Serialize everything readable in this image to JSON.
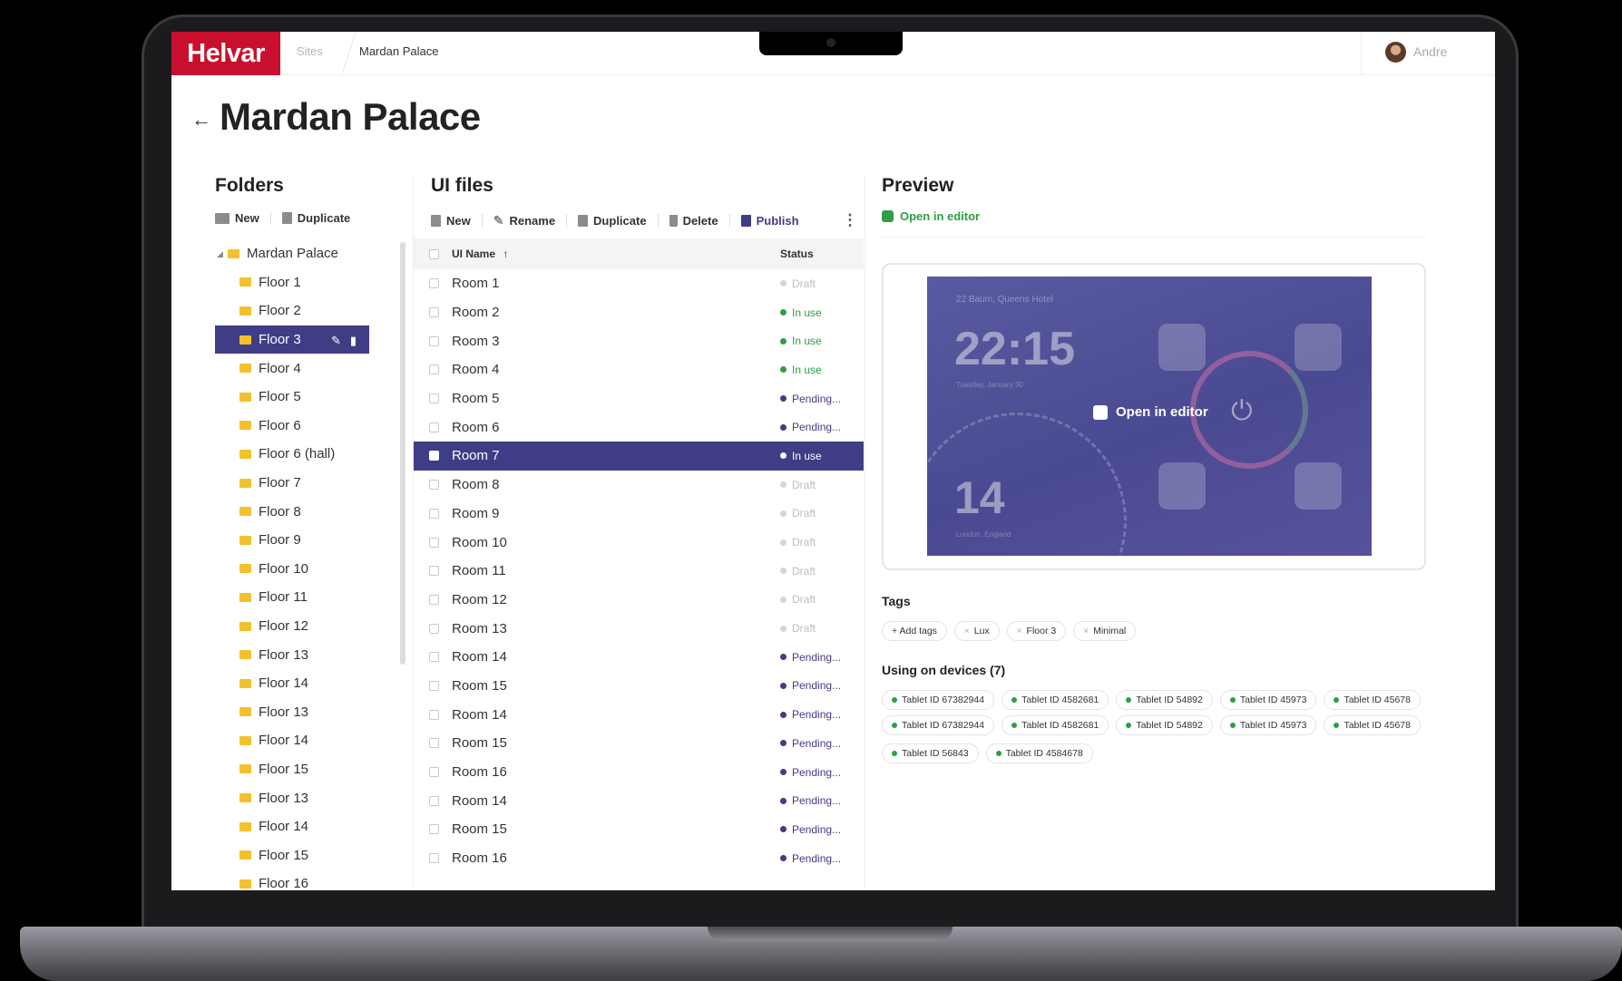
{
  "header": {
    "logo": "Helvar",
    "breadcrumb_sites": "Sites",
    "breadcrumb_current": "Mardan Palace",
    "user_name": "Andre"
  },
  "page": {
    "back_icon": "arrow-left-icon",
    "title": "Mardan Palace"
  },
  "folders": {
    "title": "Folders",
    "toolbar": {
      "new_label": "New",
      "duplicate_label": "Duplicate"
    },
    "root": "Mardan Palace",
    "items": [
      "Floor 1",
      "Floor 2",
      "Floor 3",
      "Floor 4",
      "Floor 5",
      "Floor 6",
      "Floor 6 (hall)",
      "Floor 7",
      "Floor 8",
      "Floor 9",
      "Floor 10",
      "Floor 11",
      "Floor 12",
      "Floor 13",
      "Floor 14",
      "Floor 13",
      "Floor 14",
      "Floor 15",
      "Floor 13",
      "Floor 14",
      "Floor 15",
      "Floor 16"
    ],
    "selected_index": 2
  },
  "ui_files": {
    "title": "UI files",
    "toolbar": {
      "new_label": "New",
      "rename_label": "Rename",
      "duplicate_label": "Duplicate",
      "delete_label": "Delete",
      "publish_label": "Publish"
    },
    "columns": {
      "name": "UI Name",
      "sort_indicator": "↑",
      "status": "Status"
    },
    "rows": [
      {
        "name": "Room 1",
        "status": "Draft",
        "kind": "draft"
      },
      {
        "name": "Room 2",
        "status": "In use",
        "kind": "inuse"
      },
      {
        "name": "Room 3",
        "status": "In use",
        "kind": "inuse"
      },
      {
        "name": "Room 4",
        "status": "In use",
        "kind": "inuse"
      },
      {
        "name": "Room 5",
        "status": "Pending...",
        "kind": "pending"
      },
      {
        "name": "Room 6",
        "status": "Pending...",
        "kind": "pending"
      },
      {
        "name": "Room 7",
        "status": "In use",
        "kind": "inuse"
      },
      {
        "name": "Room 8",
        "status": "Draft",
        "kind": "draft"
      },
      {
        "name": "Room 9",
        "status": "Draft",
        "kind": "draft"
      },
      {
        "name": "Room 10",
        "status": "Draft",
        "kind": "draft"
      },
      {
        "name": "Room 11",
        "status": "Draft",
        "kind": "draft"
      },
      {
        "name": "Room 12",
        "status": "Draft",
        "kind": "draft"
      },
      {
        "name": "Room 13",
        "status": "Draft",
        "kind": "draft"
      },
      {
        "name": "Room 14",
        "status": "Pending...",
        "kind": "pending"
      },
      {
        "name": "Room 15",
        "status": "Pending...",
        "kind": "pending"
      },
      {
        "name": "Room 14",
        "status": "Pending...",
        "kind": "pending"
      },
      {
        "name": "Room 15",
        "status": "Pending...",
        "kind": "pending"
      },
      {
        "name": "Room 16",
        "status": "Pending...",
        "kind": "pending"
      },
      {
        "name": "Room 14",
        "status": "Pending...",
        "kind": "pending"
      },
      {
        "name": "Room 15",
        "status": "Pending...",
        "kind": "pending"
      },
      {
        "name": "Room 16",
        "status": "Pending...",
        "kind": "pending"
      }
    ],
    "selected_index": 6
  },
  "preview": {
    "title": "Preview",
    "open_editor_label": "Open in editor",
    "screen": {
      "caption": "22 Baum, Queens Hotel",
      "time": "22:15",
      "date": "Tuesday, January 30",
      "temperature": "14",
      "location": "London, England",
      "overlay_label": "Open in editor"
    },
    "tags_title": "Tags",
    "add_tags_label": "+ Add tags",
    "tags": [
      "Lux",
      "Floor 3",
      "Minimal"
    ],
    "devices_title": "Using on devices (7)",
    "devices": [
      [
        "Tablet ID 67382944",
        "Tablet ID 4582681",
        "Tablet ID 54892",
        "Tablet ID 45973",
        "Tablet ID 45678"
      ],
      [
        "Tablet ID 67382944",
        "Tablet ID 4582681",
        "Tablet ID 54892",
        "Tablet ID 45973",
        "Tablet ID 45678"
      ],
      [
        "Tablet ID 56843",
        "Tablet ID 4584678"
      ]
    ]
  },
  "colors": {
    "brand": "#c8102e",
    "selection": "#3f3d86",
    "in_use": "#2f9e44",
    "folder": "#f2c12e"
  }
}
